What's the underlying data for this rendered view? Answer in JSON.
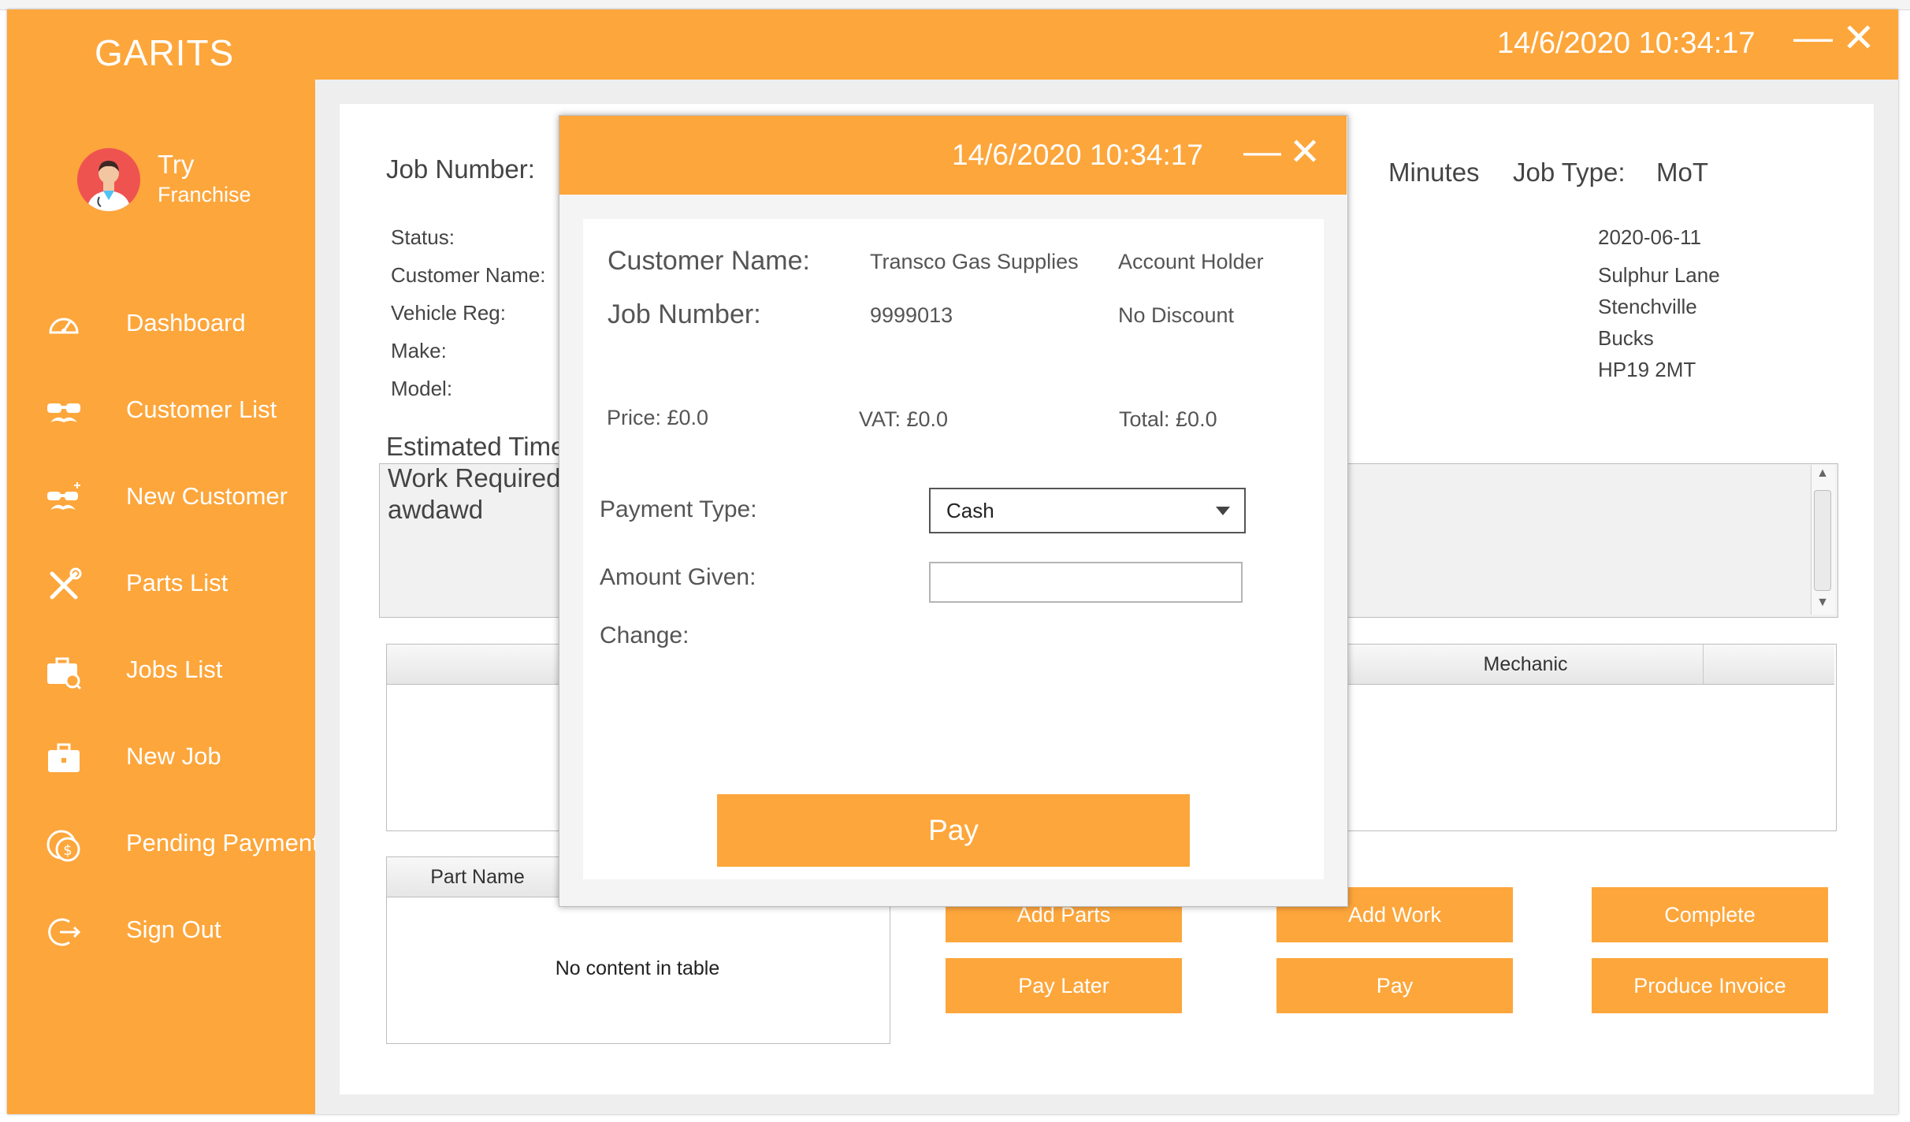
{
  "window": {
    "app_title": "GARITS",
    "datetime": "14/6/2020 10:34:17",
    "minimize_glyph": "—",
    "close_glyph": "✕"
  },
  "user": {
    "name": "Try",
    "role": "Franchise"
  },
  "sidebar": {
    "items": [
      {
        "label": "Dashboard",
        "icon": "dashboard-icon"
      },
      {
        "label": "Customer List",
        "icon": "mustache-glasses-icon"
      },
      {
        "label": "New Customer",
        "icon": "add-customer-icon"
      },
      {
        "label": "Parts List",
        "icon": "tools-icon"
      },
      {
        "label": "Jobs List",
        "icon": "briefcase-search-icon"
      },
      {
        "label": "New Job",
        "icon": "briefcase-icon"
      },
      {
        "label": "Pending Payment",
        "icon": "coins-icon"
      },
      {
        "label": "Sign Out",
        "icon": "sign-out-icon"
      }
    ]
  },
  "job": {
    "job_number_label": "Job Number:",
    "minutes_label": "Minutes",
    "job_type_label": "Job Type:",
    "job_type_value": "MoT",
    "status_label": "Status:",
    "customer_name_label": "Customer Name:",
    "vehicle_reg_label": "Vehicle Reg:",
    "make_label": "Make:",
    "model_label": "Model:",
    "date_value": "2020-06-11",
    "address_lines": [
      "Sulphur Lane",
      "Stenchville",
      "Bucks",
      "HP19 2MT"
    ],
    "estimated_time_label": "Estimated Time",
    "work_required_label": "Work Required:",
    "work_required_text": "awdawd"
  },
  "tasks_table": {
    "columns": [
      "Mechanic"
    ]
  },
  "parts_table": {
    "columns": [
      "Part Name"
    ],
    "empty_text": "No content in table"
  },
  "actions": {
    "add_parts": "Add Parts",
    "add_work": "Add Work",
    "complete": "Complete",
    "pay_later": "Pay Later",
    "pay": "Pay",
    "produce_invoice": "Produce Invoice"
  },
  "dialog": {
    "datetime": "14/6/2020 10:34:17",
    "customer_name_label": "Customer Name:",
    "customer_name_value": "Transco Gas Supplies",
    "account_type": "Account Holder",
    "job_number_label": "Job Number:",
    "job_number_value": "9999013",
    "discount": "No Discount",
    "price": "Price: £0.0",
    "vat": "VAT: £0.0",
    "total": "Total: £0.0",
    "payment_type_label": "Payment Type:",
    "payment_type_value": "Cash",
    "amount_given_label": "Amount Given:",
    "amount_given_value": "",
    "change_label": "Change:",
    "pay_button": "Pay"
  },
  "colors": {
    "accent": "#fda63b",
    "avatar": "#ef5350"
  }
}
